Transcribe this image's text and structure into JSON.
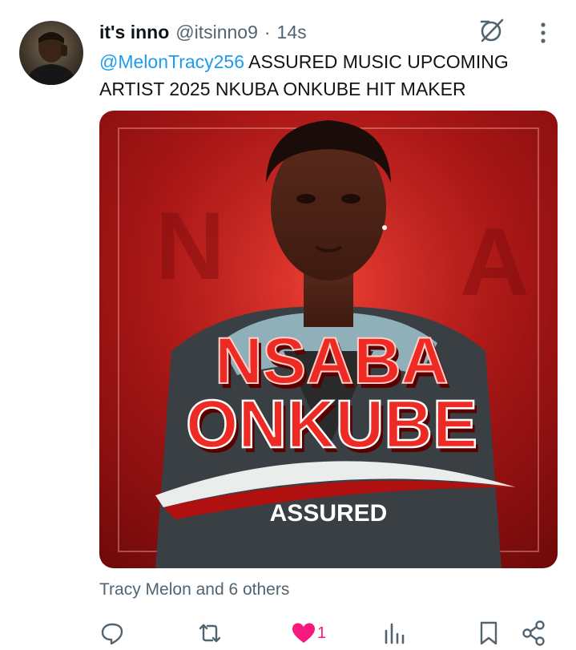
{
  "tweet": {
    "display_name": "it's inno",
    "handle": "@itsinno9",
    "separator": "·",
    "time": "14s",
    "mention": "@MelonTracy256",
    "body": " ASSURED MUSIC UPCOMING ARTIST 2025 NKUBA ONKUBE HIT MAKER"
  },
  "media": {
    "title_line1": "NSABA",
    "title_line2": "ONKUBE",
    "artist": "ASSURED"
  },
  "likers": "Tracy Melon and 6 others",
  "actions": {
    "like_count": "1"
  },
  "colors": {
    "accent": "#1d9bf0",
    "like": "#f91880",
    "muted": "#536471",
    "poster_red": "#c8201f"
  },
  "icons": [
    "grok-icon",
    "more-icon",
    "reply-icon",
    "retweet-icon",
    "heart-icon",
    "views-icon",
    "bookmark-icon",
    "share-icon"
  ]
}
